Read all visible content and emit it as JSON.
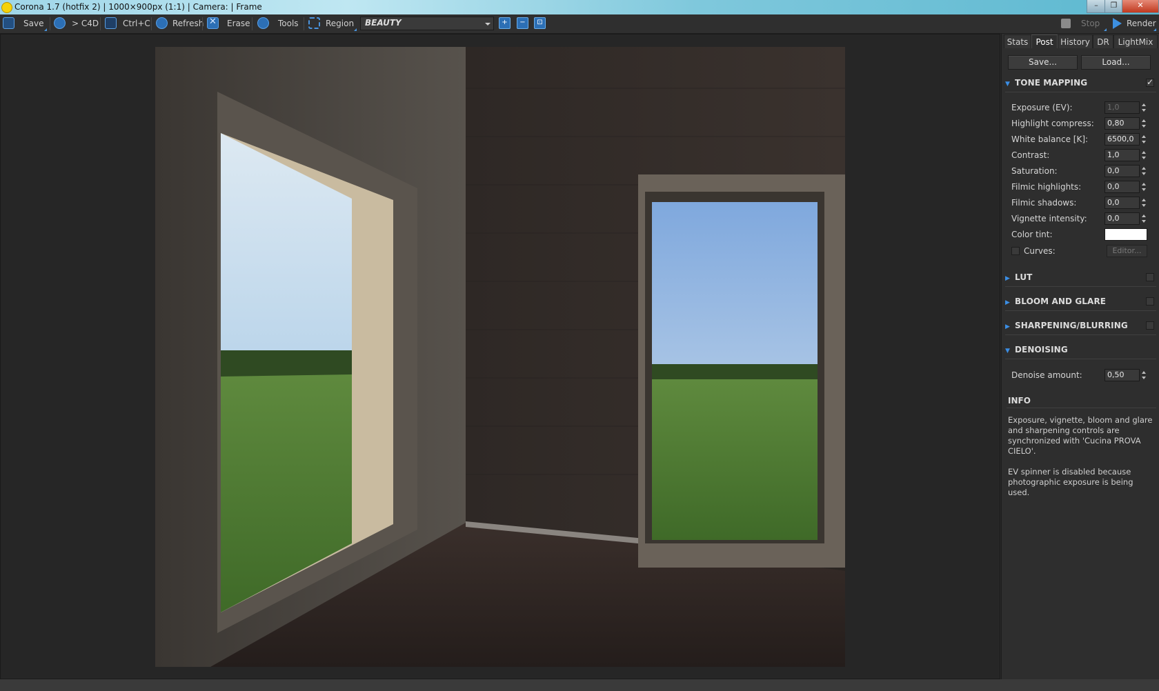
{
  "window": {
    "title": "Corona 1.7 (hotfix 2) | 1000×900px (1:1) | Camera:  | Frame",
    "min": "–",
    "max": "❐",
    "close": "✕"
  },
  "toolbar": {
    "save": "Save",
    "to_c4d": "> C4D",
    "copy": "Ctrl+C",
    "refresh": "Refresh",
    "erase": "Erase",
    "tools": "Tools",
    "region": "Region",
    "channel": "BEAUTY",
    "zoom_in": "+",
    "zoom_out": "−",
    "zoom_fit": "⊡",
    "stop": "Stop",
    "render": "Render"
  },
  "panel": {
    "tabs": [
      "Stats",
      "Post",
      "History",
      "DR",
      "LightMix"
    ],
    "active_tab": "Post",
    "save_btn": "Save...",
    "load_btn": "Load...",
    "tone_mapping": {
      "title": "TONE MAPPING",
      "enabled": true,
      "exposure_label": "Exposure (EV):",
      "exposure": "1,0",
      "highlight_label": "Highlight compress:",
      "highlight": "0,80",
      "wb_label": "White balance [K]:",
      "wb": "6500,0",
      "contrast_label": "Contrast:",
      "contrast": "1,0",
      "saturation_label": "Saturation:",
      "saturation": "0,0",
      "fhigh_label": "Filmic highlights:",
      "fhigh": "0,0",
      "fshadow_label": "Filmic shadows:",
      "fshadow": "0,0",
      "vignette_label": "Vignette intensity:",
      "vignette": "0,0",
      "tint_label": "Color tint:",
      "tint_color": "#ffffff",
      "curves_label": "Curves:",
      "editor": "Editor..."
    },
    "lut": "LUT",
    "bloom": "BLOOM AND GLARE",
    "sharpen": "SHARPENING/BLURRING",
    "denoising": {
      "title": "DENOISING",
      "amount_label": "Denoise amount:",
      "amount": "0,50"
    },
    "info": {
      "title": "INFO",
      "text1": "Exposure, vignette, bloom and glare and sharpening controls are synchronized with 'Cucina PROVA CIELO'.",
      "text2": "EV spinner is disabled because photographic exposure is being used."
    }
  }
}
